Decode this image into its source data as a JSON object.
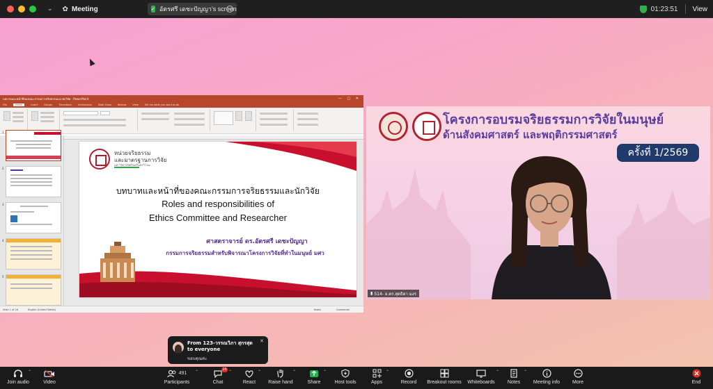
{
  "window": {
    "app_title": "Meeting",
    "share_indicator": "อัตรศรี เดชะปัญญา's screen",
    "timer": "01:23:51",
    "view_label": "View"
  },
  "colors": {
    "toolbar_bg": "#1a1a1a",
    "ppt_accent": "#b7472a",
    "slide_purple": "#5a2c91",
    "video_title": "#5b3f9e",
    "round_badge": "#1f3a6b",
    "end_red": "#e02828",
    "security_green": "#2fb24c"
  },
  "powerpoint": {
    "title_bar": "บทบาทและหน้าที่ของคณะกรรมการจริยธรรมและนักวิจัย - PowerPoint",
    "tabs": [
      "File",
      "Home",
      "Insert",
      "Design",
      "Transitions",
      "Animations",
      "Slide Show",
      "Review",
      "View",
      "Tell me what you want to do"
    ],
    "active_tab": "Home",
    "status_slide": "Slide 1 of 18",
    "status_lang": "English (United States)",
    "status_notes": "Notes",
    "status_comments": "Comments",
    "slide": {
      "org_line1": "หน่วยจริยธรรม",
      "org_line2": "และมาตรฐานการวิจัย",
      "org_line3": "มหาวิทยาลัยศรีนครินทรวิโรฒ",
      "title_th": "บทบาทและหน้าที่ของคณะกรรมการจริยธรรมและนักวิจัย",
      "title_en1": "Roles and responsibilities of",
      "title_en2": "Ethics Committee and Researcher",
      "author": "ศาสตราจารย์ ดร.อัตรศรี เดชะปัญญา",
      "committee": "กรรมการจริยธรรมสำหรับพิจารณาโครงการวิจัยที่ทำในมนุษย์ มศว"
    },
    "thumb_numbers": [
      "1",
      "2",
      "3",
      "4",
      "5"
    ]
  },
  "video": {
    "title_line1": "โครงการอบรมจริยธรรมการวิจัยในมนุษย์",
    "title_line2": "ด้านสังคมศาสตร์ และพฤติกรรมศาสตร์",
    "round_label": "ครั้งที่ 1/2569",
    "participant_name": "514- อ.ดร.สุดธิดา มงร"
  },
  "chat_toast": {
    "from": "From 123-วรรณวิภา สุกรสุด to everyone",
    "message": "ขอบคุณค่ะ",
    "close_icon": "close-icon"
  },
  "toolbar": {
    "participant_count": "491",
    "chat_badge": "26",
    "buttons": [
      {
        "id": "join-audio",
        "label": "Join audio",
        "icon": "headphones-icon"
      },
      {
        "id": "video",
        "label": "Video",
        "icon": "video-off-icon"
      },
      {
        "id": "participants",
        "label": "Participants",
        "icon": "people-icon"
      },
      {
        "id": "chat",
        "label": "Chat",
        "icon": "chat-icon"
      },
      {
        "id": "react",
        "label": "React",
        "icon": "heart-icon"
      },
      {
        "id": "raise-hand",
        "label": "Raise hand",
        "icon": "hand-icon"
      },
      {
        "id": "share",
        "label": "Share",
        "icon": "share-arrow-icon"
      },
      {
        "id": "host-tools",
        "label": "Host tools",
        "icon": "shield-icon"
      },
      {
        "id": "apps",
        "label": "Apps",
        "icon": "apps-icon"
      },
      {
        "id": "record",
        "label": "Record",
        "icon": "record-icon"
      },
      {
        "id": "breakout-rooms",
        "label": "Breakout rooms",
        "icon": "grid-icon"
      },
      {
        "id": "whiteboards",
        "label": "Whiteboards",
        "icon": "whiteboard-icon"
      },
      {
        "id": "notes",
        "label": "Notes",
        "icon": "notes-icon"
      },
      {
        "id": "meeting-info",
        "label": "Meeting info",
        "icon": "info-icon"
      },
      {
        "id": "more",
        "label": "More",
        "icon": "more-icon"
      },
      {
        "id": "end",
        "label": "End",
        "icon": "end-icon"
      }
    ]
  }
}
